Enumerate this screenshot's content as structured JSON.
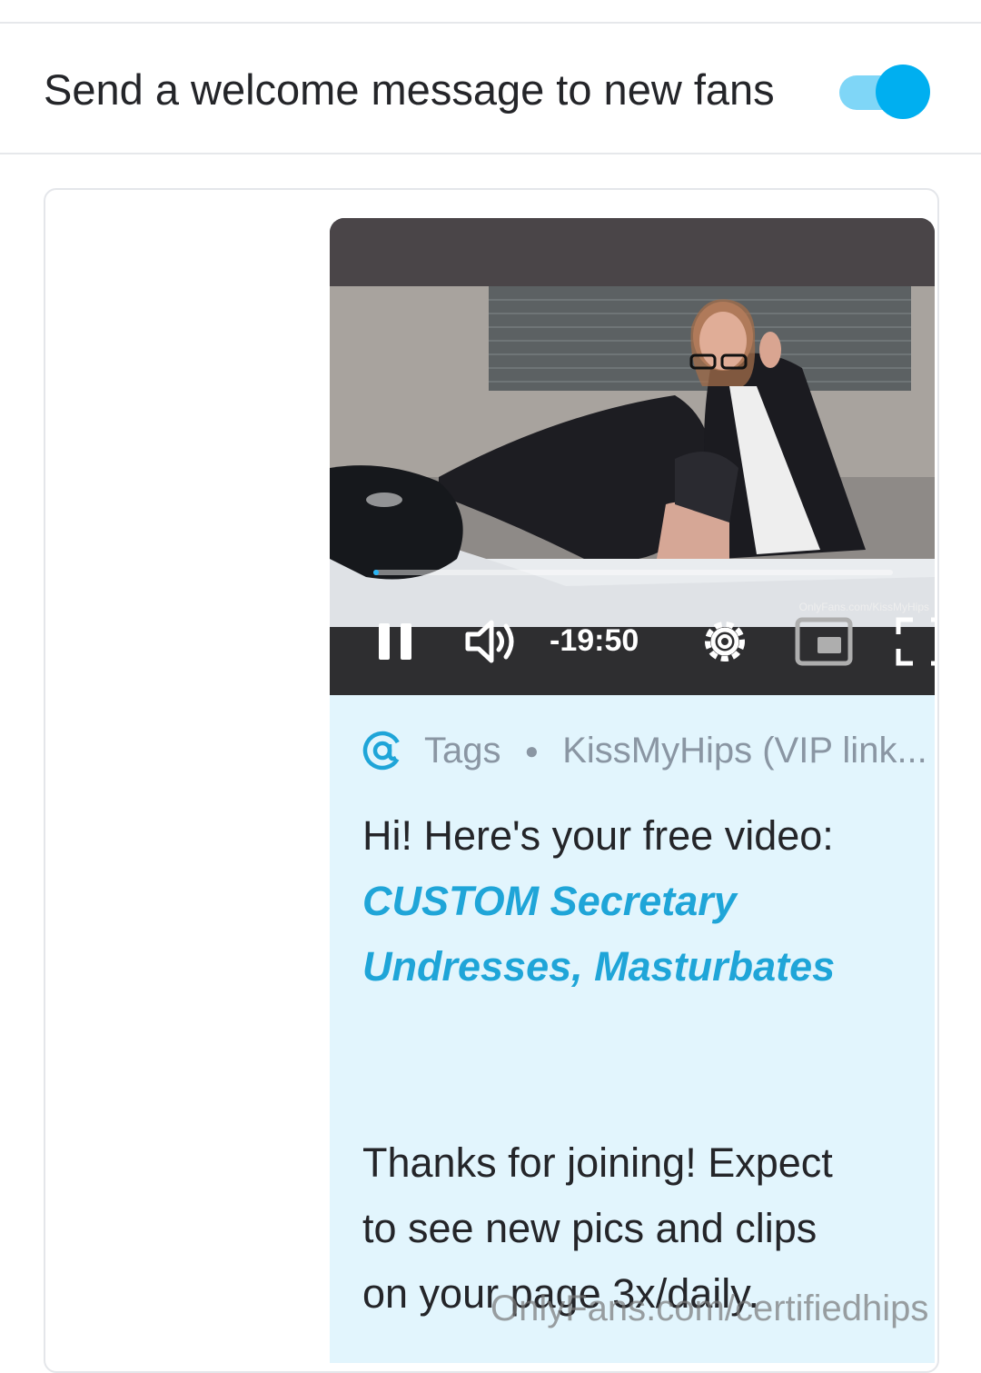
{
  "settings": {
    "welcome_label": "Send a welcome message to new fans",
    "welcome_enabled": true
  },
  "video": {
    "time_remaining": "-19:50",
    "watermark": "OnlyFans.com/KissMyHips",
    "progress_fraction": 0.01,
    "icons": [
      "pause-icon",
      "volume-icon",
      "settings-gear-icon",
      "picture-in-picture-icon",
      "fullscreen-icon"
    ]
  },
  "message": {
    "tags_label": "Tags",
    "tag_text": "KissMyHips (VIP link...",
    "intro": "Hi! Here's your free video:",
    "video_link_line1": "CUSTOM Secretary",
    "video_link_line2": "Undresses, Masturbates",
    "body_line1": "Thanks for joining! Expect",
    "body_line2": "to see new pics and clips",
    "body_line3": "on your page 3x/daily."
  },
  "page_watermark": "OnlyFans.com/certifiedhips",
  "colors": {
    "accent": "#00aff0",
    "bubble": "#e2f5fd",
    "link": "#1fa5d8",
    "text": "#242529",
    "muted": "#8a96a3"
  }
}
